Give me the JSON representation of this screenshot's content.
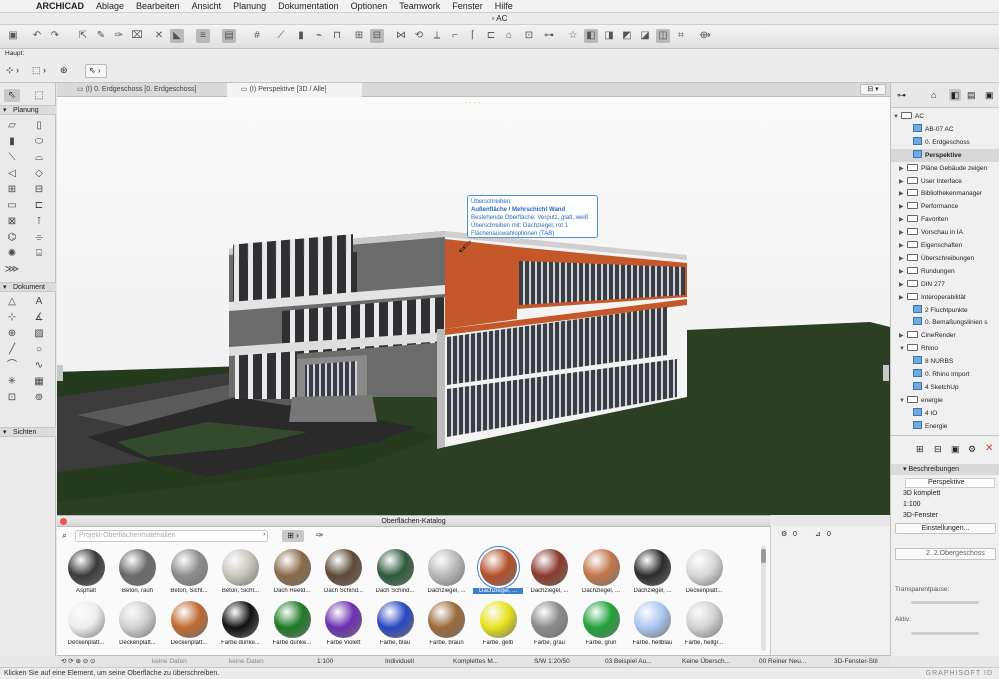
{
  "menu": {
    "app": "ARCHICAD",
    "items": [
      "Ablage",
      "Bearbeiten",
      "Ansicht",
      "Planung",
      "Dokumentation",
      "Optionen",
      "Teamwork",
      "Fenster",
      "Hilfe"
    ]
  },
  "window_title": "AC",
  "toolbar": {
    "haupt_label": "Haupt:"
  },
  "toolbox": {
    "sections": {
      "planung": "Planung",
      "dokument": "Dokument",
      "sichten": "Sichten"
    }
  },
  "tabs": [
    {
      "label": "(I) 0. Erdgeschoss [0. Erdgeschoss]"
    },
    {
      "label": "(I) Perspektive [3D / Alle]"
    }
  ],
  "tooltip": {
    "line1": "Überschreiben:",
    "line2": "Außenfläche / Mehrschicht Wand",
    "line3": "Bestehende Oberfläche: Verputz, glatt, weiß",
    "line4": "Überschreiben mit: Dachziegel, rot 1",
    "line5": "Flächenauswahloptionen (TAB)"
  },
  "catalog": {
    "title": "Oberflächen-Katalog",
    "search_placeholder": "Projekt-Oberflächenmaterialien",
    "materials": [
      {
        "label": "Asphalt",
        "color": "#3a3a3a"
      },
      {
        "label": "Beton, rauh",
        "color": "#6a6a6a"
      },
      {
        "label": "Beton, Sicht...",
        "color": "#8d8d8d"
      },
      {
        "label": "Beton, Sicht...",
        "color": "#c9c5be"
      },
      {
        "label": "Dach Reetd...",
        "color": "#8a6a48"
      },
      {
        "label": "Dach Schind...",
        "color": "#5e4a36"
      },
      {
        "label": "Dach Schind...",
        "color": "#2f5a3e"
      },
      {
        "label": "Dachziegel, ...",
        "color": "#b9b9b9"
      },
      {
        "label": "Dachziegel, ...",
        "color": "#b4502a"
      },
      {
        "label": "Dachziegel, ...",
        "color": "#8a3a2c"
      },
      {
        "label": "Dachziegel, ...",
        "color": "#c2764a"
      },
      {
        "label": "Dachziegel, ...",
        "color": "#2c2c2c"
      },
      {
        "label": "Deckenplatt...",
        "color": "#d8d8d8"
      },
      {
        "label": "Deckenplatt...",
        "color": "#eeeeee"
      },
      {
        "label": "Deckenplatt...",
        "color": "#d0d0d0"
      },
      {
        "label": "Deckenplatt...",
        "color": "#c06a30"
      },
      {
        "label": "Farbe dunke...",
        "color": "#111111"
      },
      {
        "label": "Farbe dunke...",
        "color": "#1d7a24"
      },
      {
        "label": "Farbe Violett",
        "color": "#6a2fb0"
      },
      {
        "label": "Farbe, blau",
        "color": "#2b46c2"
      },
      {
        "label": "Farbe, braun",
        "color": "#9a6a3a"
      },
      {
        "label": "Farbe, gelb",
        "color": "#e8e21a"
      },
      {
        "label": "Farbe, grau",
        "color": "#8a8a8a"
      },
      {
        "label": "Farbe, grün",
        "color": "#1fa23a"
      },
      {
        "label": "Farbe, hellblau",
        "color": "#aac6f0"
      },
      {
        "label": "Farbe, hellgr...",
        "color": "#d2d2d2"
      }
    ],
    "selected_index": 8,
    "counter_left": "0",
    "counter_right": "0"
  },
  "navigator": {
    "items": [
      {
        "label": "AC",
        "type": "root"
      },
      {
        "label": "AB-07 AC",
        "type": "view"
      },
      {
        "label": "0. Erdgeschoss",
        "type": "view"
      },
      {
        "label": "Perspektive",
        "type": "view",
        "selected": true
      },
      {
        "label": "Pläne Gebäude zeigen",
        "type": "folder"
      },
      {
        "label": "User Interface",
        "type": "folder"
      },
      {
        "label": "Bibliothekenmanager",
        "type": "folder"
      },
      {
        "label": "Performance",
        "type": "folder"
      },
      {
        "label": "Favoriten",
        "type": "folder"
      },
      {
        "label": "Vorschau in IA",
        "type": "folder"
      },
      {
        "label": "Eigenschaften",
        "type": "folder"
      },
      {
        "label": "Überschreibungen",
        "type": "folder"
      },
      {
        "label": "Rundungen",
        "type": "folder"
      },
      {
        "label": "DIN 277",
        "type": "folder"
      },
      {
        "label": "Interoperabilität",
        "type": "folder"
      },
      {
        "label": "2 Fluchtpunkte",
        "type": "view"
      },
      {
        "label": "0. Bemaßungslinien s",
        "type": "view"
      },
      {
        "label": "CineRender",
        "type": "folder"
      },
      {
        "label": "Rhino",
        "type": "folder"
      },
      {
        "label": "8 NURBS",
        "type": "view"
      },
      {
        "label": "0. Rhino Import",
        "type": "view"
      },
      {
        "label": "4 SketchUp",
        "type": "view"
      },
      {
        "label": "energie",
        "type": "folder"
      },
      {
        "label": "4 IO",
        "type": "view"
      },
      {
        "label": "Energie",
        "type": "view"
      }
    ],
    "props": {
      "header": "Beschreibungen",
      "name": "Perspektive",
      "line1": "3D komplett",
      "line2": "1:100",
      "line3": "3D-Fenster",
      "button": "Einstellungen...",
      "storey": "2. 2.Obergeschoss",
      "transparency": "Transparentpause:",
      "aktiv": "Aktiv:"
    }
  },
  "statusbar": {
    "items": [
      "keine Daten",
      "keine Daten",
      "1:100",
      "Individuell",
      "Komplettes M...",
      "S/W 1:20/50",
      "03 Beispiel Au...",
      "Keine Übersch...",
      "00 Reiner Neu...",
      "3D-Fenster-Stil"
    ]
  },
  "hint": "Klicken Sie auf eine Element, um seine Oberfläche zu überschreiben.",
  "brand": "GRAPHISOFT ID"
}
